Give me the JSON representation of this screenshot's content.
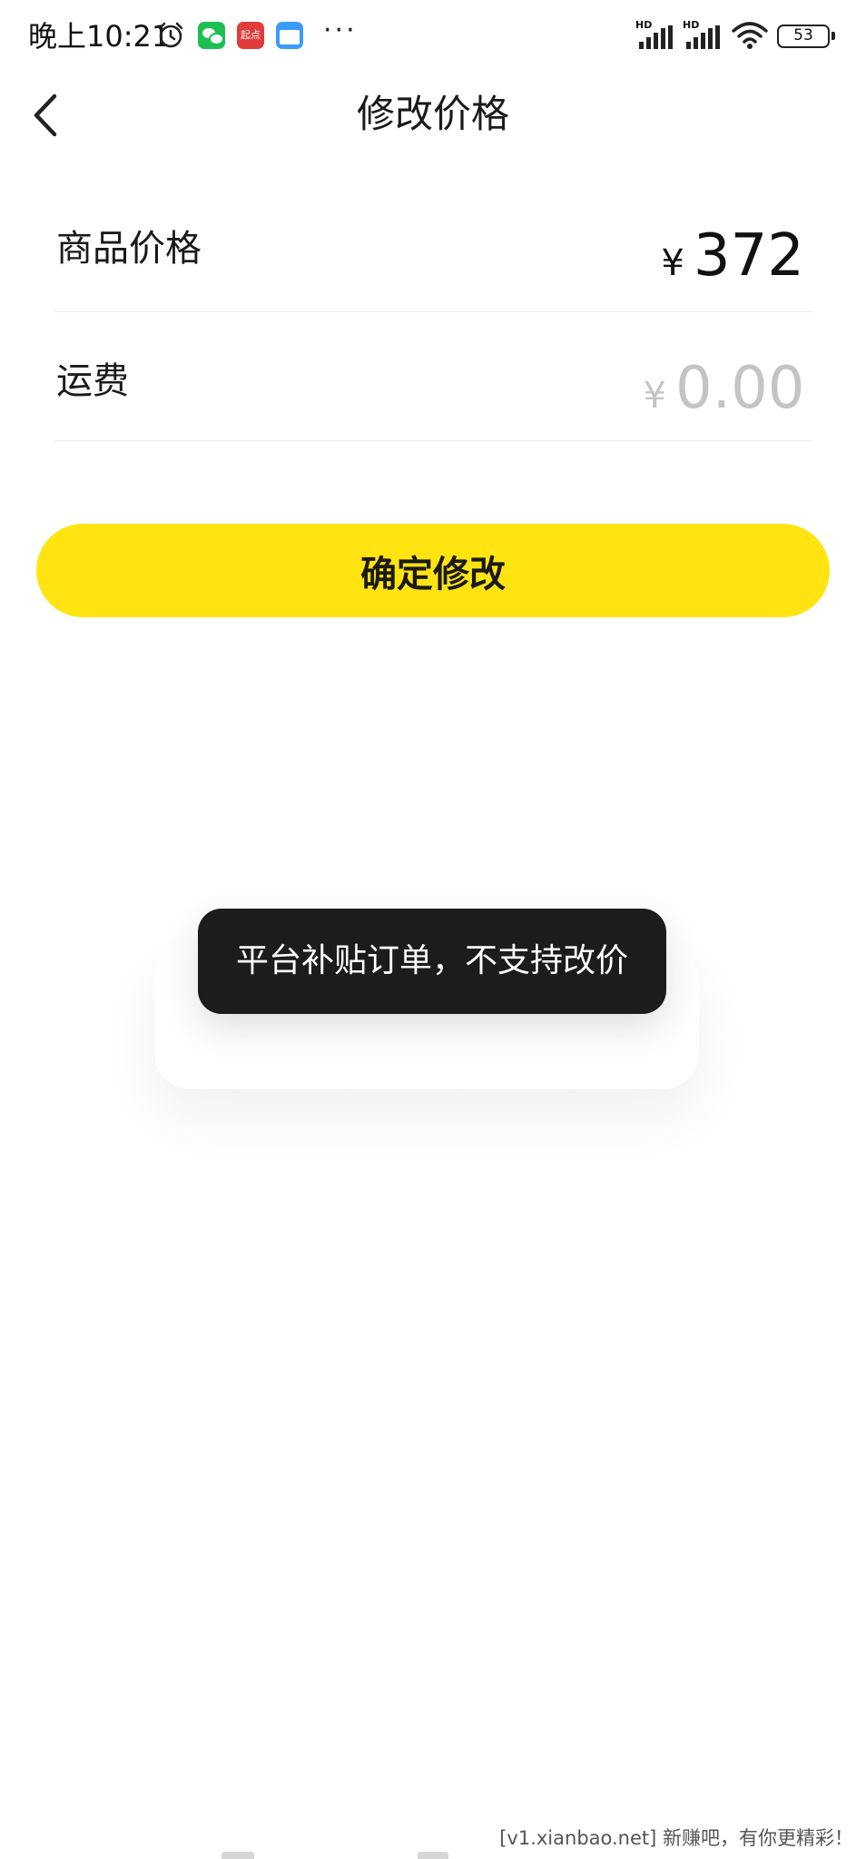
{
  "status_bar": {
    "time": "晚上10:21",
    "qidian_text": "起点",
    "more": "···",
    "signal1_label": "HD",
    "signal2_label": "HD",
    "battery": "53",
    "icons": [
      "alarm-icon",
      "wechat-icon",
      "qidian-icon",
      "calendar-icon",
      "signal-icon",
      "wifi-icon",
      "battery-icon"
    ]
  },
  "nav": {
    "title": "修改价格",
    "back_icon": "chevron-left-icon"
  },
  "form": {
    "price": {
      "label": "商品价格",
      "currency": "¥",
      "value": "372"
    },
    "shipping": {
      "label": "运费",
      "currency": "¥",
      "placeholder": "0.00"
    }
  },
  "confirm_button": {
    "label": "确定修改",
    "color": "#ffe411"
  },
  "toast": {
    "message": "平台补贴订单，不支持改价"
  },
  "watermark": "[v1.xianbao.net] 新赚吧，有你更精彩！"
}
